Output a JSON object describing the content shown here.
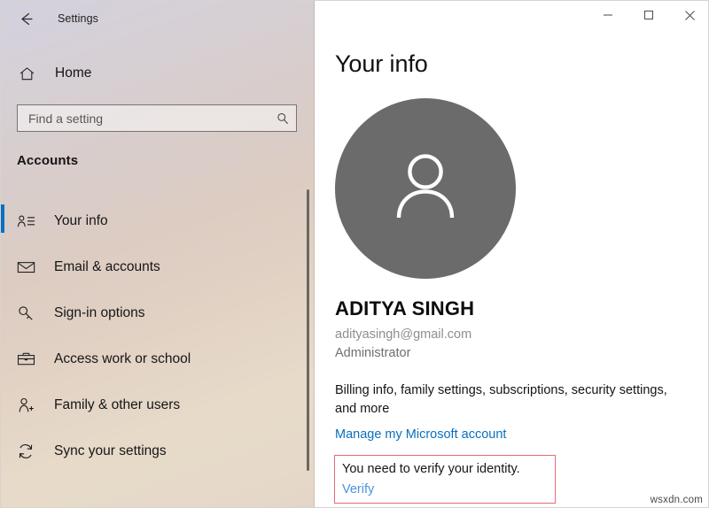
{
  "window": {
    "app_title": "Settings",
    "back_icon": "back-arrow-icon",
    "controls": {
      "minimize": "minimize-icon",
      "maximize": "maximize-icon",
      "close": "close-icon"
    }
  },
  "sidebar": {
    "home": {
      "label": "Home",
      "icon": "home-icon"
    },
    "search": {
      "placeholder": "Find a setting",
      "value": "",
      "icon": "search-icon"
    },
    "section_title": "Accounts",
    "items": [
      {
        "label": "Your info",
        "icon": "contact-card-icon",
        "selected": true
      },
      {
        "label": "Email & accounts",
        "icon": "envelope-icon",
        "selected": false
      },
      {
        "label": "Sign-in options",
        "icon": "key-icon",
        "selected": false
      },
      {
        "label": "Access work or school",
        "icon": "briefcase-icon",
        "selected": false
      },
      {
        "label": "Family & other users",
        "icon": "person-plus-icon",
        "selected": false
      },
      {
        "label": "Sync your settings",
        "icon": "sync-icon",
        "selected": false
      }
    ],
    "accent_color": "#0a6fc2"
  },
  "main": {
    "title": "Your info",
    "avatar": {
      "icon": "person-avatar-icon",
      "background": "#6b6b6b"
    },
    "account_name": "ADITYA SINGH",
    "account_email": "adityasingh@gmail.com",
    "account_role": "Administrator",
    "billing_text": "Billing info, family settings, subscriptions, security settings, and more",
    "manage_link": "Manage my Microsoft account",
    "manage_link_color": "#0a6ebd",
    "verify": {
      "message": "You need to verify your identity.",
      "link": "Verify",
      "border_color": "#e36c78",
      "link_color": "#4a93d9"
    }
  },
  "watermark": "wsxdn.com"
}
